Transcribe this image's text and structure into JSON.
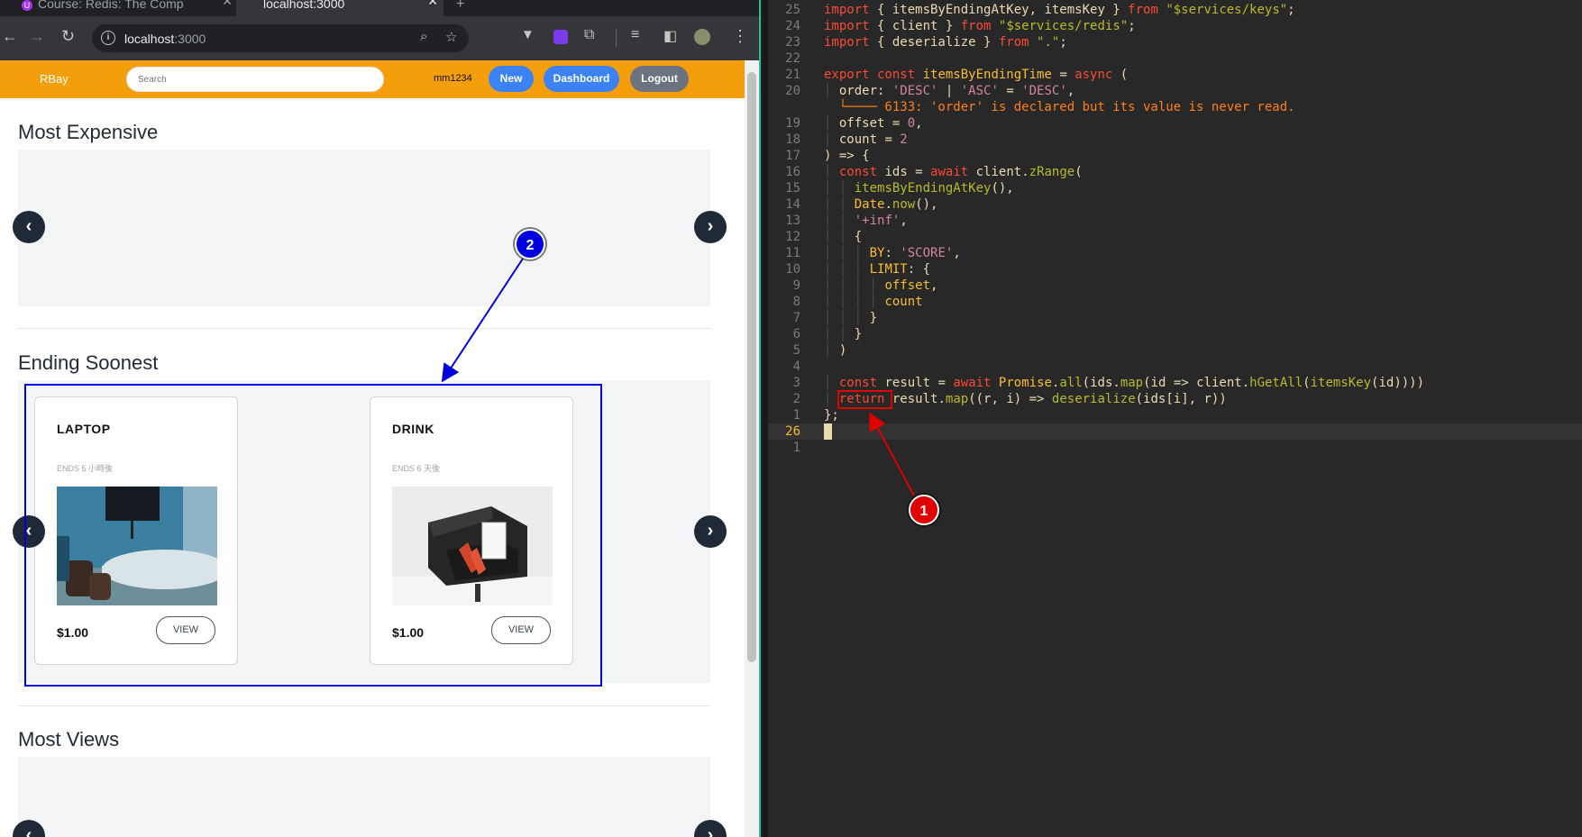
{
  "browser": {
    "tabs": [
      {
        "title": "Course: Redis: The Comp",
        "active": false
      },
      {
        "title": "localhost:3000",
        "active": true
      }
    ],
    "url_host": "localhost",
    "url_port": ":3000"
  },
  "page": {
    "brand": "RBay",
    "search_placeholder": "Search",
    "username": "mm1234",
    "nav_buttons": {
      "new": "New",
      "dashboard": "Dashboard",
      "logout": "Logout"
    },
    "sections": {
      "most_expensive": "Most Expensive",
      "ending_soonest": "Ending Soonest",
      "most_views": "Most Views"
    },
    "cards": [
      {
        "name": "LAPTOP",
        "ends": "ENDS 5 小時後",
        "price": "$1.00",
        "view": "VIEW"
      },
      {
        "name": "DRINK",
        "ends": "ENDS 6 天後",
        "price": "$1.00",
        "view": "VIEW"
      }
    ]
  },
  "annotations": {
    "badge1": "1",
    "badge2": "2"
  },
  "editor": {
    "line_numbers": [
      "25",
      "24",
      "23",
      "22",
      "21",
      "20",
      "",
      "19",
      "18",
      "17",
      "16",
      "15",
      "14",
      "13",
      "12",
      "11",
      "10",
      "9",
      "8",
      "7",
      "6",
      "5",
      "4",
      "3",
      "2",
      "1",
      "26",
      "1"
    ],
    "lines": [
      "import { itemsByEndingAtKey, itemsKey } from \"$services/keys\";",
      "import { client } from \"$services/redis\";",
      "import { deserialize } from \".\";",
      "",
      "export const itemsByEndingTime = async (",
      "  order: 'DESC' | 'ASC' = 'DESC',",
      "  └──── 6133: 'order' is declared but its value is never read.",
      "  offset = 0,",
      "  count = 2",
      ") => {",
      "  const ids = await client.zRange(",
      "    itemsByEndingAtKey(),",
      "    Date.now(),",
      "    '+inf',",
      "    {",
      "      BY: 'SCORE',",
      "      LIMIT: {",
      "        offset,",
      "        count",
      "      }",
      "    }",
      "  )",
      "",
      "  const result = await Promise.all(ids.map(id => client.hGetAll(itemsKey(id))))",
      "  return result.map((r, i) => deserialize(ids[i], r))",
      "};",
      "",
      ""
    ]
  },
  "colors": {
    "nav": "#f59e0b",
    "new_btn": "#3b82f6",
    "dashboard_btn": "#3b82f6",
    "logout_btn": "#6b7280",
    "annotation_red": "#e00000",
    "annotation_blue": "#0000e0"
  }
}
